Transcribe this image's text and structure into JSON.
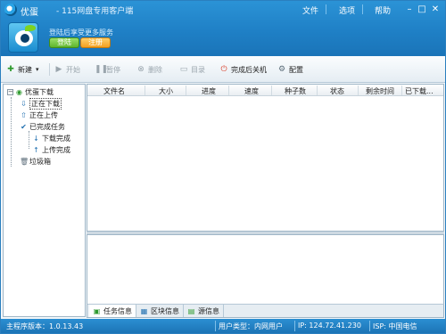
{
  "app": {
    "name": "优蛋",
    "subtitle": "-  115网盘专用客户端"
  },
  "menu": [
    "文件",
    "选项",
    "帮助"
  ],
  "account": {
    "tip": "登陆后享受更多服务",
    "login_label": "登陆",
    "register_label": "注册"
  },
  "toolbar": {
    "new": "新建",
    "start": "开始",
    "pause": "暂停",
    "delete": "删除",
    "directory": "目录",
    "shutdown_after": "完成后关机",
    "config": "配置"
  },
  "tree": {
    "root": "优蛋下载",
    "downloading": "正在下载",
    "uploading": "正在上传",
    "completed": "已完成任务",
    "download_done": "下载完成",
    "upload_done": "上传完成",
    "recycle": "垃圾箱"
  },
  "table": {
    "columns": [
      "文件名",
      "大小",
      "进度",
      "速度",
      "种子数",
      "状态",
      "剩余时间",
      "已下载..."
    ],
    "rows": []
  },
  "tabs": [
    "任务信息",
    "区块信息",
    "源信息"
  ],
  "status": {
    "version": "主程序版本：1.0.13.43",
    "user_type": "用户类型：内网用户",
    "ip": "IP: 124.72.41.230",
    "isp": "ISP: 中国电信"
  },
  "colors": {
    "accent": "#1f80c6",
    "toolbar_bg": "#e5edf3"
  }
}
